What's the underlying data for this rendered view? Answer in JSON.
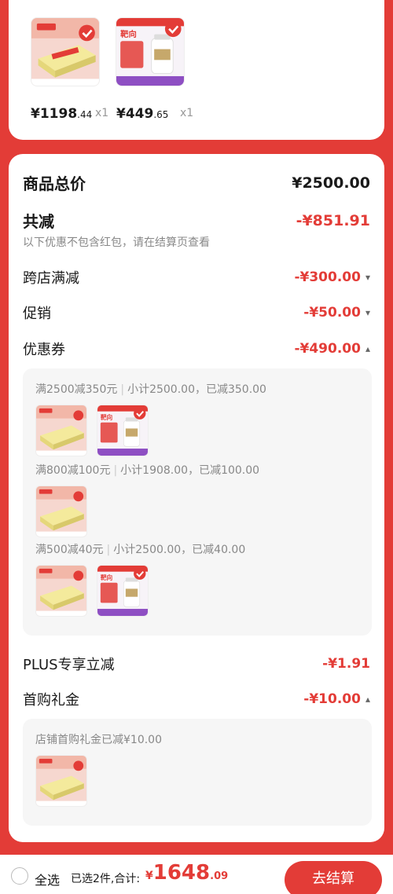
{
  "top_items": [
    {
      "price_int": "¥1198",
      "price_dec": ".44",
      "qty": "x1"
    },
    {
      "price_int": "¥449",
      "price_dec": ".65",
      "qty": "x1"
    }
  ],
  "summary": {
    "total_label": "商品总价",
    "total_value": "¥2500.00",
    "reduce_label": "共减",
    "reduce_value": "-¥851.91",
    "reduce_note": "以下优惠不包含红包，请在结算页查看",
    "cross_store_label": "跨店满减",
    "cross_store_value": "-¥300.00",
    "promo_label": "促销",
    "promo_value": "-¥50.00",
    "coupon_label": "优惠券",
    "coupon_value": "-¥490.00",
    "plus_label": "PLUS专享立减",
    "plus_value": "-¥1.91",
    "gift_label": "首购礼金",
    "gift_value": "-¥10.00"
  },
  "coupon_panel": {
    "c1_rule": "满2500减350元",
    "c1_detail": "小计2500.00，已减350.00",
    "c2_rule": "满800减100元",
    "c2_detail": "小计1908.00，已减100.00",
    "c3_rule": "满500减40元",
    "c3_detail": "小计2500.00，已减40.00"
  },
  "gift_panel": {
    "text": "店铺首购礼金已减¥10.00"
  },
  "bottom": {
    "select_all": "全选",
    "selected_text": "已选2件,合计:",
    "currency": "¥",
    "total_int": "1648",
    "total_dec": ".09",
    "checkout_label": "去结算"
  },
  "colors": {
    "accent": "#e33c37"
  },
  "icons": [
    "chevron-down-icon",
    "chevron-up-icon",
    "radio-unchecked-icon"
  ]
}
